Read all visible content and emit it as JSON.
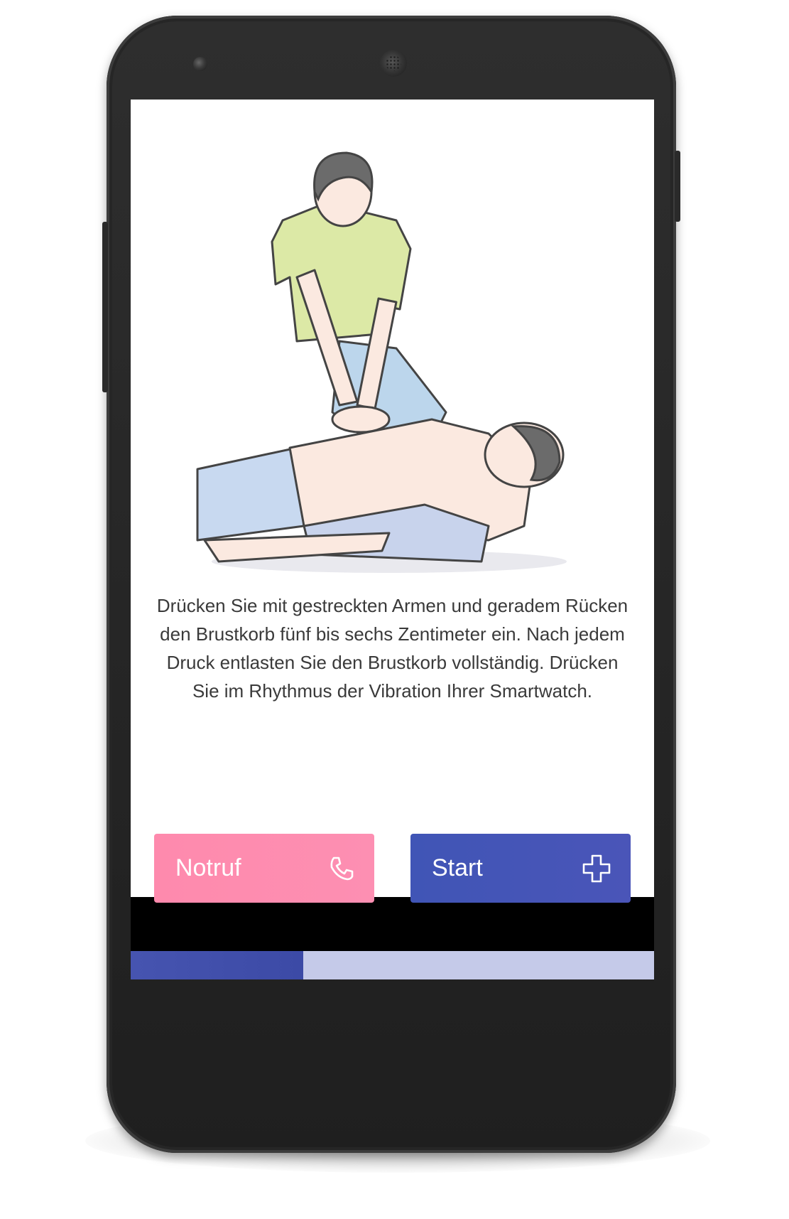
{
  "instruction_text": "Drücken Sie mit gestreckten Armen und geradem Rücken den Brustkorb fünf bis sechs Zentimeter ein. Nach jedem Druck entlasten Sie den Brustkorb vollständig. Drücken Sie im Rhythmus der Vibration Ihrer Smartwatch.",
  "buttons": {
    "emergency": {
      "label": "Notruf",
      "icon": "phone-icon",
      "color": "#fe8aad"
    },
    "start": {
      "label": "Start",
      "icon": "plus-icon",
      "color": "#4653b7"
    }
  },
  "progress": {
    "value": 0.33,
    "fill_color": "#4452b0",
    "track_color": "#c5cae9"
  },
  "navigation": {
    "back": "back-icon",
    "home": "home-icon",
    "recent": "recent-apps-icon"
  }
}
